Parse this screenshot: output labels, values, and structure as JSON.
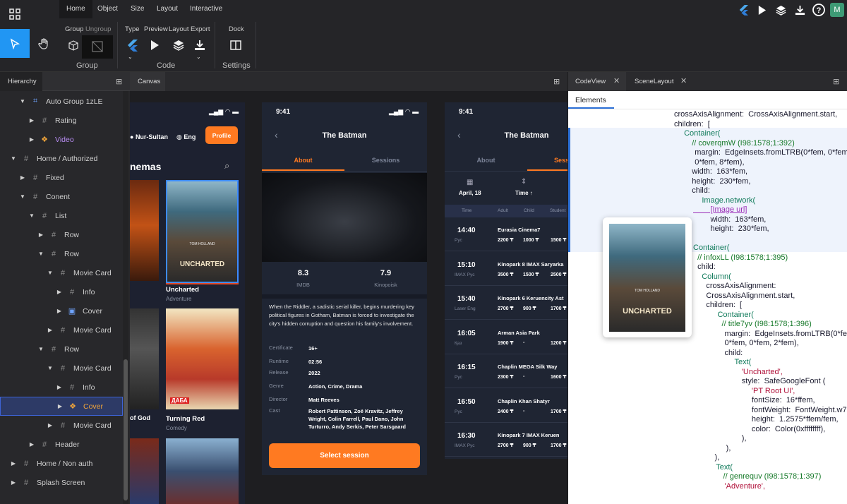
{
  "menu": {
    "tabs": [
      "Home",
      "Object",
      "Size",
      "Layout",
      "Interactive"
    ]
  },
  "toolbar": {
    "group_labels": [
      "Group",
      "Ungroup"
    ],
    "group_title": "Group",
    "code_labels": [
      "Type",
      "Preview",
      "Layout",
      "Export"
    ],
    "code_title": "Code",
    "settings_label": "Dock",
    "settings_title": "Settings"
  },
  "user": {
    "avatar_letter": "M"
  },
  "hierarchy": {
    "title": "Hierarchy",
    "items": [
      {
        "label": "Auto Group 1zLE",
        "icon": "frame-icon"
      },
      {
        "label": "Rating",
        "icon": "hash-icon"
      },
      {
        "label": "Video",
        "icon": "component-icon"
      },
      {
        "label": "Home / Authorized",
        "icon": "hash-icon"
      },
      {
        "label": "Fixed",
        "icon": "hash-icon"
      },
      {
        "label": "Conent",
        "icon": "hash-icon"
      },
      {
        "label": "List",
        "icon": "hash-icon"
      },
      {
        "label": "Row",
        "icon": "hash-icon"
      },
      {
        "label": "Row",
        "icon": "hash-icon"
      },
      {
        "label": "Movie Card",
        "icon": "hash-icon"
      },
      {
        "label": "Info",
        "icon": "hash-icon"
      },
      {
        "label": "Cover",
        "icon": "image-icon"
      },
      {
        "label": "Movie Card",
        "icon": "hash-icon"
      },
      {
        "label": "Row",
        "icon": "hash-icon"
      },
      {
        "label": "Movie Card",
        "icon": "hash-icon"
      },
      {
        "label": "Info",
        "icon": "hash-icon"
      },
      {
        "label": "Cover",
        "icon": "component-icon"
      },
      {
        "label": "Movie Card",
        "icon": "hash-icon"
      },
      {
        "label": "Header",
        "icon": "hash-icon"
      },
      {
        "label": "Home / Non auth",
        "icon": "hash-icon"
      },
      {
        "label": "Splash Screen",
        "icon": "hash-icon"
      }
    ]
  },
  "canvas": {
    "title": "Canvas",
    "phone1": {
      "city": "Nur-Sultan",
      "lang": "Eng",
      "profile_button": "Profile",
      "section_title": "nemas",
      "card1_title": "Uncharted",
      "card1_genre": "Adventure",
      "card2_title": "Turning Red",
      "card2_genre": "Comedy",
      "left_card_title": "of God",
      "poster_uncharted_text": "UNCHARTED",
      "poster_uncharted_names": "TOM HOLLAND",
      "poster_red_text": "ДАБА"
    },
    "phone2": {
      "time": "9:41",
      "title": "The Batman",
      "tab_about": "About",
      "tab_sessions": "Sessions",
      "rating1_value": "8.3",
      "rating1_label": "IMDB",
      "rating2_value": "7.9",
      "rating2_label": "Kinopoisk",
      "description": "When the Riddler, a sadistic serial killer, begins murdering key political figures in Gotham, Batman is forced to investigate the city's hidden corruption and question his family's involvement.",
      "details": [
        {
          "k": "Certificate",
          "v": "16+"
        },
        {
          "k": "Runtime",
          "v": "02:56"
        },
        {
          "k": "Release",
          "v": "2022"
        },
        {
          "k": "Genre",
          "v": "Action, Crime, Drama"
        },
        {
          "k": "Director",
          "v": "Matt Reeves"
        },
        {
          "k": "Cast",
          "v": "Robert Pattinson, Zoë Kravitz, Jeffrey Wright, Colin Farrell, Paul Dano, John Turturro, Andy Serkis, Peter Sarsgaard"
        }
      ],
      "button": "Select session"
    },
    "phone3": {
      "time": "9:41",
      "title": "The Batman",
      "tab_about": "About",
      "tab_sessions": "Sess",
      "date": "April, 18",
      "sort": "Time ↑",
      "headers": [
        "Time",
        "Adult",
        "Child",
        "Student"
      ],
      "sessions": [
        {
          "time": "14:40",
          "sub": "Рус",
          "cinema": "Eurasia Cinema7",
          "adult": "2200 ₸",
          "child": "1000 ₸",
          "student": "1500 ₸"
        },
        {
          "time": "15:10",
          "sub": "IMAX  Рус",
          "cinema": "Kinopark 8 IMAX Saryarka",
          "adult": "3500 ₸",
          "child": "1500 ₸",
          "student": "2500 ₸"
        },
        {
          "time": "15:40",
          "sub": "Laser  Eng",
          "cinema": "Kinopark 6 Keruencity Ast",
          "adult": "2700 ₸",
          "child": "900 ₸",
          "student": "1700 ₸"
        },
        {
          "time": "16:05",
          "sub": "Қаз",
          "cinema": "Arman Asia Park",
          "adult": "1900 ₸",
          "child": "-",
          "student": "1200 ₸"
        },
        {
          "time": "16:15",
          "sub": "Рус",
          "cinema": "Chaplin MEGA Silk Way",
          "adult": "2300 ₸",
          "child": "-",
          "student": "1600 ₸"
        },
        {
          "time": "16:50",
          "sub": "Рус",
          "cinema": "Chaplin Khan Shatyr",
          "adult": "2400 ₸",
          "child": "-",
          "student": "1700 ₸"
        },
        {
          "time": "16:30",
          "sub": "IMAX  Рус",
          "cinema": "Kinopark 7 IMAX Keruen",
          "adult": "2700 ₸",
          "child": "900 ₸",
          "student": "1700 ₸"
        }
      ]
    }
  },
  "codeview": {
    "tabs": [
      "CodeView",
      "SceneLayout"
    ],
    "subtab": "Elements",
    "lines": [
      "crossAxisAlignment:  CrossAxisAlignment.start,",
      "children:  [",
      "  Container(",
      "    // coverqmW (I98:1578;1:392)",
      "    margin:  EdgeInsets.fromLTRB(0*fem, 0*fem,",
      "    0*fem, 8*fem),",
      "    width:  163*fem,",
      "    height:  230*fem,",
      "    child:",
      "      Image.network(",
      "        [Image url]",
      "        width:  163*fem,",
      "        height:  230*fem,",
      "",
      "Container(",
      "  // infoxLL (I98:1578;1:395)",
      "  child:",
      "    Column(",
      "      crossAxisAlignment:",
      "      CrossAxisAlignment.start,",
      "      children:  [",
      "        Container(",
      "          // title7yv (I98:1578;1:396)",
      "          margin:  EdgeInsets.fromLTRB(0*fem,",
      "          0*fem, 0*fem, 2*fem),",
      "          child:",
      "            Text(",
      "              'Uncharted',",
      "              style:  SafeGoogleFont (",
      "                'PT Root UI',",
      "                fontSize:  16*ffem,",
      "                fontWeight:  FontWeight.w700,",
      "                height:  1.2575*ffem/fem,",
      "                color:  Color(0xffffffff),",
      "              ),",
      "            ),",
      "          ),",
      "        Text(",
      "          // genrequv (I98:1578;1:397)",
      "          'Adventure',"
    ]
  },
  "colors": {
    "accent": "#2196f3",
    "orange": "#ff7a21",
    "selection": "#2d3a66"
  }
}
